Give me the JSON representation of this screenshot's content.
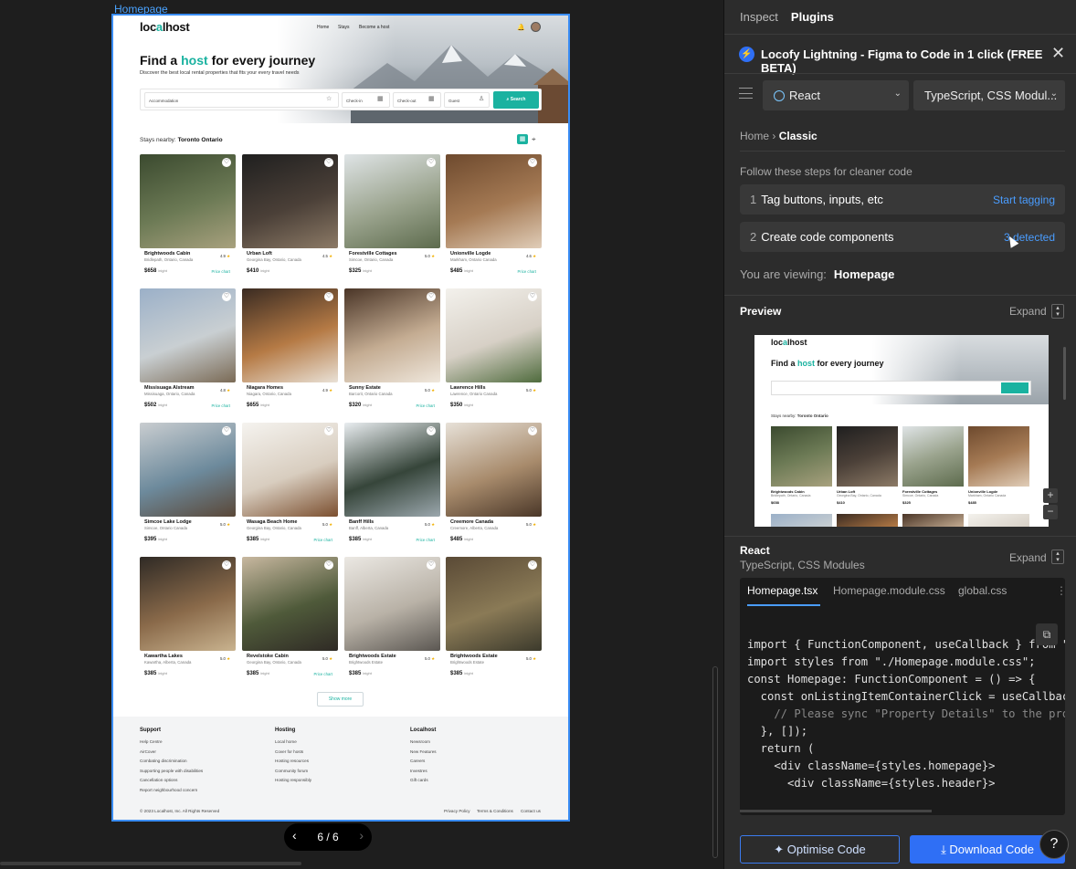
{
  "canvas": {
    "frame_label": "Homepage",
    "pager": {
      "text": "6 / 6"
    }
  },
  "site": {
    "logo_a": "loc",
    "logo_b": "a",
    "logo_c": "lhost",
    "nav": [
      "Home",
      "Stays",
      "Become a host"
    ],
    "hero_title_a": "Find a ",
    "hero_title_hl": "host",
    "hero_title_b": " for every journey",
    "hero_subtitle": "Discover the best local rental properties that fits your every travel needs",
    "search": {
      "accommodation": "Accommodation",
      "checkin": "Check-in",
      "checkout": "Check-out",
      "guest": "Guest",
      "button": "Search"
    },
    "nearby_label": "Stays nearby:",
    "nearby_city": "Toronto Ontario",
    "listings": [
      {
        "name": "Brightwoods Cabin",
        "loc": "Bridlepath, Ontario, Canada",
        "rating": "4.9",
        "price": "$658",
        "unit": "/night",
        "chart": "Price chart",
        "palette": [
          "#3b4a2f",
          "#6c7a55",
          "#a8a17e"
        ]
      },
      {
        "name": "Urban Loft",
        "loc": "Georgina Bay, Ontario, Canada",
        "rating": "4.5",
        "price": "$410",
        "unit": "/night",
        "chart": "",
        "palette": [
          "#1f1f1f",
          "#4b4038",
          "#8c7a66"
        ]
      },
      {
        "name": "Forestville Cottages",
        "loc": "Simcoe, Ontario, Canada",
        "rating": "5.0",
        "price": "$325",
        "unit": "/night",
        "chart": "",
        "palette": [
          "#dfe4e6",
          "#9aa38d",
          "#5d6b4d"
        ]
      },
      {
        "name": "Unionville Logde",
        "loc": "Markham, Ontario Canada",
        "rating": "4.6",
        "price": "$485",
        "unit": "/night",
        "chart": "Price chart",
        "palette": [
          "#6e4a2e",
          "#a57a54",
          "#e0cdb8"
        ]
      },
      {
        "name": "Missisuaga Alstream",
        "loc": "Missisuaga, Ontario, Canada",
        "rating": "4.8",
        "price": "$502",
        "unit": "/night",
        "chart": "Price chart",
        "palette": [
          "#9bb0c8",
          "#c9cfd2",
          "#7a6a55"
        ]
      },
      {
        "name": "Niagara Homes",
        "loc": "Niagara, Ontario, Canada",
        "rating": "4.9",
        "price": "$655",
        "unit": "/night",
        "chart": "",
        "palette": [
          "#3a2b22",
          "#b57a45",
          "#e9e1d6"
        ]
      },
      {
        "name": "Sunny Estate",
        "loc": "Barcorit, Ontario Canada",
        "rating": "5.0",
        "price": "$320",
        "unit": "/night",
        "chart": "Price chart",
        "palette": [
          "#4a3527",
          "#c4ac92",
          "#efe7dc"
        ]
      },
      {
        "name": "Lawrence Hills",
        "loc": "Lawrence, Ontario Canada",
        "rating": "5.0",
        "price": "$350",
        "unit": "/night",
        "chart": "",
        "palette": [
          "#f3f1ec",
          "#d7d0c6",
          "#4f6b3d"
        ]
      },
      {
        "name": "Simcoe Lake Lodge",
        "loc": "Simcoe, Ontario Canada",
        "rating": "5.0",
        "price": "$395",
        "unit": "/night",
        "chart": "",
        "palette": [
          "#c9cdd0",
          "#6d8a9c",
          "#5a4737"
        ]
      },
      {
        "name": "Wasaga Beach Home",
        "loc": "Georgina Bay, Ontario, Canada",
        "rating": "5.0",
        "price": "$385",
        "unit": "/night",
        "chart": "Price chart",
        "palette": [
          "#f5f3ef",
          "#d8cdbf",
          "#7b4f2f"
        ]
      },
      {
        "name": "Banff Hills",
        "loc": "Banff, Alberta, Canada",
        "rating": "5.0",
        "price": "$385",
        "unit": "/night",
        "chart": "Price chart",
        "palette": [
          "#e9edf0",
          "#36453a",
          "#9ba7ad"
        ]
      },
      {
        "name": "Creemore Canada",
        "loc": "Creemore, Alberta, Canada",
        "rating": "5.0",
        "price": "$485",
        "unit": "/night",
        "chart": "",
        "palette": [
          "#e7e1d8",
          "#a88b6c",
          "#4a3728"
        ]
      },
      {
        "name": "Kawartha Lakes",
        "loc": "Kawartha, Alberta, Canada",
        "rating": "5.0",
        "price": "$385",
        "unit": "/night",
        "chart": "",
        "palette": [
          "#2f2a25",
          "#8a6a4a",
          "#c9b38f"
        ]
      },
      {
        "name": "Revelstoke Cabin",
        "loc": "Georgina Bay, Ontario, Canada",
        "rating": "5.0",
        "price": "$385",
        "unit": "/night",
        "chart": "Price chart",
        "palette": [
          "#c8b8a0",
          "#4f5a3a",
          "#2f2a25"
        ]
      },
      {
        "name": "Brightwoods Estate",
        "loc": "Brightwoods Estate",
        "rating": "5.0",
        "price": "$385",
        "unit": "/night",
        "chart": "",
        "palette": [
          "#ebe8e3",
          "#b9b2a7",
          "#5b5752"
        ]
      },
      {
        "name": "Brightwoods Estate",
        "loc": "Brightwoods Estate",
        "rating": "5.0",
        "price": "$385",
        "unit": "/night",
        "chart": "",
        "palette": [
          "#5a4a36",
          "#8a7a56",
          "#3c3a2c"
        ]
      }
    ],
    "show_more": "Show more",
    "footer": {
      "cols": [
        {
          "title": "Support",
          "links": [
            "Help Centre",
            "AirCover",
            "Combating discrimination",
            "Supporting people with disabilities",
            "Cancellation options",
            "Report neighbourhood concern"
          ]
        },
        {
          "title": "Hosting",
          "links": [
            "Local home",
            "Cover for hosts",
            "Hosting resources",
            "Community forum",
            "Hosting responsibly"
          ]
        },
        {
          "title": "Localhost",
          "links": [
            "Newsroom",
            "New Features",
            "Careers",
            "Investres",
            "Gift cards"
          ]
        }
      ],
      "copyright": "© 2023 Localhost, Inc. All Rights Reserved",
      "legal": [
        "Privacy Policy",
        "Terms & Conditions",
        "Contact us"
      ]
    }
  },
  "panel": {
    "tabs": [
      "Inspect",
      "Plugins"
    ],
    "plugin_title": "Locofy Lightning - Figma to Code in 1 click (FREE BETA)",
    "framework": "React",
    "language": "TypeScript, CSS Modul...",
    "breadcrumb_home": "Home",
    "breadcrumb_current": "Classic",
    "steps_heading": "Follow these steps for cleaner code",
    "step1_n": "1",
    "step1_label": "Tag buttons, inputs, etc",
    "step1_action": "Start tagging",
    "step2_n": "2",
    "step2_label": "Create code components",
    "step2_action": "3 detected",
    "viewing_label": "You are viewing:",
    "viewing_value": "Homepage",
    "preview_heading": "Preview",
    "expand": "Expand",
    "react_heading": "React",
    "react_sub": "TypeScript, CSS Modules",
    "code_tabs": [
      "Homepage.tsx",
      "Homepage.module.css",
      "global.css"
    ],
    "code_lines": [
      "import { FunctionComponent, useCallback } from \"",
      "import styles from \"./Homepage.module.css\";",
      "",
      "const Homepage: FunctionComponent = () => {",
      "  const onListingItemContainerClick = useCallbac",
      "    // Please sync \"Property Details\" to the pro",
      "  }, []);",
      "",
      "  return (",
      "    <div className={styles.homepage}>",
      "      <div className={styles.header}>"
    ],
    "btn_optimise": "Optimise Code",
    "btn_download": "Download Code",
    "help": "?"
  }
}
